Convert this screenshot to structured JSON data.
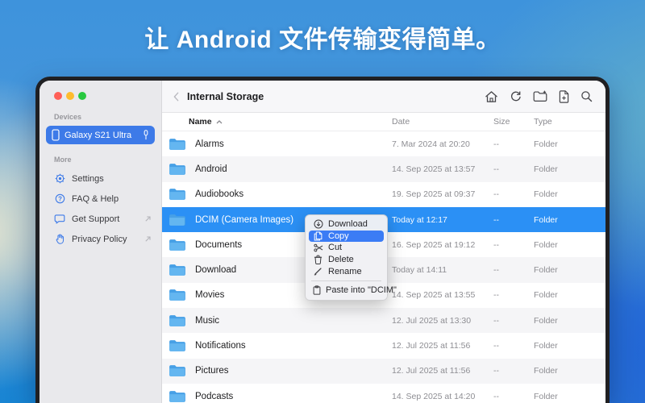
{
  "hero": {
    "title": "让 Android 文件传输变得简单。"
  },
  "colors": {
    "accent": "#3d7ae8",
    "row_selection": "#2b90f5",
    "menu_highlight": "#3b7cf5",
    "folder_icon": "#57ade9",
    "hero_text": "#ffffff"
  },
  "window_controls": [
    "close",
    "minimize",
    "zoom"
  ],
  "sidebar": {
    "devices_label": "Devices",
    "device": {
      "name": "Galaxy S21 Ultra",
      "icon": "smartphone-icon",
      "status_icon": "usb-connector-icon"
    },
    "more_label": "More",
    "items": [
      {
        "label": "Settings",
        "icon": "gear-icon",
        "external": false
      },
      {
        "label": "FAQ & Help",
        "icon": "help-circle-icon",
        "external": false
      },
      {
        "label": "Get Support",
        "icon": "chat-bubble-icon",
        "external": true
      },
      {
        "label": "Privacy Policy",
        "icon": "hand-privacy-icon",
        "external": true
      }
    ]
  },
  "toolbar": {
    "title": "Internal Storage",
    "back_icon": "chevron-left-icon",
    "actions": [
      {
        "name": "home-button",
        "icon": "home-icon"
      },
      {
        "name": "refresh-button",
        "icon": "refresh-icon"
      },
      {
        "name": "new-folder-button",
        "icon": "new-folder-icon"
      },
      {
        "name": "new-file-button",
        "icon": "new-file-icon"
      },
      {
        "name": "search-button",
        "icon": "search-icon"
      }
    ]
  },
  "table": {
    "columns": [
      {
        "label": "Name",
        "sort": "asc"
      },
      {
        "label": "Date"
      },
      {
        "label": "Size"
      },
      {
        "label": "Type"
      }
    ],
    "row_icon": "folder-icon",
    "rows": [
      {
        "name": "Alarms",
        "date": "7. Mar 2024 at 20:20",
        "size": "--",
        "type": "Folder",
        "selected": false
      },
      {
        "name": "Android",
        "date": "14. Sep 2025 at 13:57",
        "size": "--",
        "type": "Folder",
        "selected": false
      },
      {
        "name": "Audiobooks",
        "date": "19. Sep 2025 at 09:37",
        "size": "--",
        "type": "Folder",
        "selected": false
      },
      {
        "name": "DCIM (Camera Images)",
        "date": "Today at 12:17",
        "size": "--",
        "type": "Folder",
        "selected": true
      },
      {
        "name": "Documents",
        "date": "16. Sep 2025 at 19:12",
        "size": "--",
        "type": "Folder",
        "selected": false
      },
      {
        "name": "Download",
        "date": "Today at 14:11",
        "size": "--",
        "type": "Folder",
        "selected": false
      },
      {
        "name": "Movies",
        "date": "14. Sep 2025 at 13:55",
        "size": "--",
        "type": "Folder",
        "selected": false
      },
      {
        "name": "Music",
        "date": "12. Jul 2025 at 13:30",
        "size": "--",
        "type": "Folder",
        "selected": false
      },
      {
        "name": "Notifications",
        "date": "12. Jul 2025 at 11:56",
        "size": "--",
        "type": "Folder",
        "selected": false
      },
      {
        "name": "Pictures",
        "date": "12. Jul 2025 at 11:56",
        "size": "--",
        "type": "Folder",
        "selected": false
      },
      {
        "name": "Podcasts",
        "date": "14. Sep 2025 at 14:20",
        "size": "--",
        "type": "Folder",
        "selected": false
      }
    ]
  },
  "context_menu": {
    "items": [
      {
        "label": "Download",
        "icon": "download-circle-icon",
        "highlighted": false
      },
      {
        "label": "Copy",
        "icon": "copy-icon",
        "highlighted": true
      },
      {
        "label": "Cut",
        "icon": "scissors-icon",
        "highlighted": false
      },
      {
        "label": "Delete",
        "icon": "trash-icon",
        "highlighted": false
      },
      {
        "label": "Rename",
        "icon": "pencil-icon",
        "highlighted": false
      },
      {
        "divider": true
      },
      {
        "label": "Paste into \"DCIM\"",
        "icon": "clipboard-icon",
        "highlighted": false
      }
    ]
  }
}
